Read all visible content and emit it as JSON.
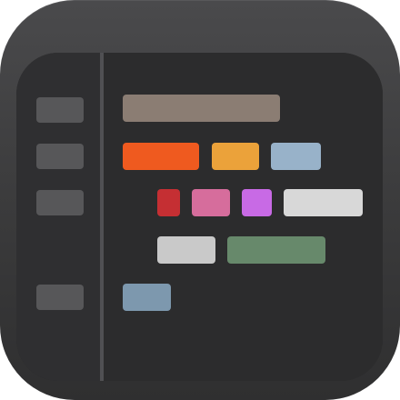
{
  "app_icon": {
    "name": "code-editor-app-icon",
    "colors": {
      "shell": "#3f3f41",
      "screen": "#2c2c2d",
      "sidebar": "#2f2f31",
      "divider": "#505053",
      "sidebar_block": "#575759"
    },
    "sidebar_blocks": [
      {
        "name": "sidebar-block-1",
        "color": "#575759"
      },
      {
        "name": "sidebar-block-2",
        "color": "#575759"
      },
      {
        "name": "sidebar-block-3",
        "color": "#575759"
      },
      {
        "name": "sidebar-block-4",
        "color": "#575759"
      }
    ],
    "code_blocks": [
      {
        "name": "code-token-taupe",
        "color": "#8b7d73"
      },
      {
        "name": "code-token-orange-red",
        "color": "#ef5a1f"
      },
      {
        "name": "code-token-amber",
        "color": "#eba23a"
      },
      {
        "name": "code-token-blue-gray",
        "color": "#98b2c9"
      },
      {
        "name": "code-token-red",
        "color": "#c52f33"
      },
      {
        "name": "code-token-pink",
        "color": "#d66d9c"
      },
      {
        "name": "code-token-violet",
        "color": "#c86ae5"
      },
      {
        "name": "code-token-light-gray",
        "color": "#d8d8d8"
      },
      {
        "name": "code-token-silver",
        "color": "#c9c9c9"
      },
      {
        "name": "code-token-green",
        "color": "#67896b"
      },
      {
        "name": "code-token-slate-blue",
        "color": "#7d98ae"
      }
    ]
  }
}
